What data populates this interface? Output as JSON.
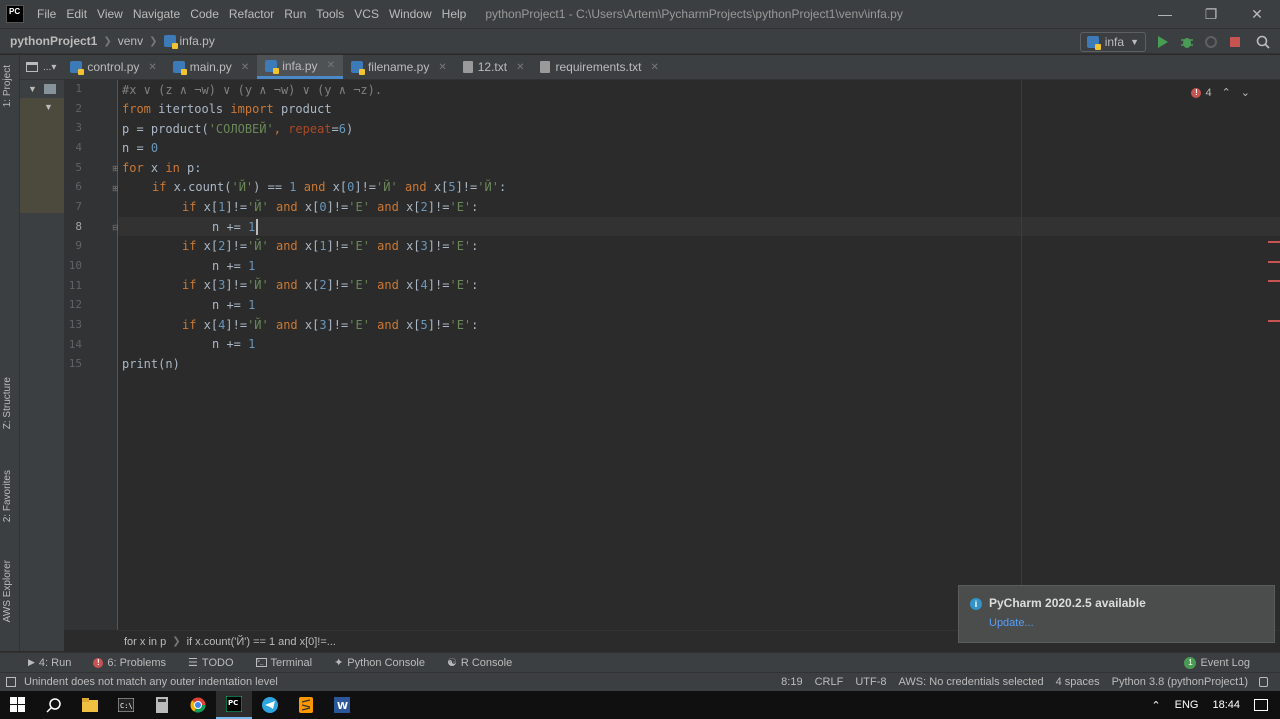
{
  "titlebar": {
    "logo": "PC",
    "menus": [
      "File",
      "Edit",
      "View",
      "Navigate",
      "Code",
      "Refactor",
      "Run",
      "Tools",
      "VCS",
      "Window",
      "Help"
    ],
    "window_title": "pythonProject1 - C:\\Users\\Artem\\PycharmProjects\\pythonProject1\\venv\\infa.py"
  },
  "navbar": {
    "project": "pythonProject1",
    "folder": "venv",
    "file": "infa.py",
    "run_config": "infa"
  },
  "tabs": [
    {
      "label": "control.py",
      "type": "py"
    },
    {
      "label": "main.py",
      "type": "py"
    },
    {
      "label": "infa.py",
      "type": "py",
      "active": true
    },
    {
      "label": "filename.py",
      "type": "py"
    },
    {
      "label": "12.txt",
      "type": "txt"
    },
    {
      "label": "requirements.txt",
      "type": "txt"
    }
  ],
  "left_strip": {
    "project": "1: Project",
    "structure": "Z: Structure",
    "favorites": "2: Favorites",
    "aws": "AWS Explorer"
  },
  "editor": {
    "line_numbers": [
      "1",
      "2",
      "3",
      "4",
      "5",
      "6",
      "7",
      "8",
      "9",
      "10",
      "11",
      "12",
      "13",
      "14",
      "15"
    ],
    "current_line": "8",
    "error_count": "4",
    "code": {
      "l1_comment": "#x ∨ (z ∧ ¬w) ∨ (y ∧ ¬w) ∨ (y ∧ ¬z).",
      "l2_from": "from",
      "l2_mod": " itertools ",
      "l2_import": "import",
      "l2_name": " product",
      "l3_a": "p = product(",
      "l3_str": "'СОЛОВЕЙ'",
      "l3_b": ", ",
      "l3_param": "repeat",
      "l3_c": "=",
      "l3_num": "6",
      "l3_d": ")",
      "l4_a": "n = ",
      "l4_num": "0",
      "l5_for": "for",
      "l5_a": " x ",
      "l5_in": "in",
      "l5_b": " p:",
      "l6_if": "if",
      "l6_a": " x.count(",
      "l6_s1": "'Й'",
      "l6_b": ") == ",
      "l6_n1": "1",
      "l6_and1": " and",
      "l6_c": " x[",
      "l6_n2": "0",
      "l6_d": "]!=",
      "l6_s2": "'Й'",
      "l6_and2": " and",
      "l6_e": " x[",
      "l6_n3": "5",
      "l6_f": "]!=",
      "l6_s3": "'Й'",
      "l6_g": ":",
      "l7_if": "if",
      "l7_a": " x[",
      "l7_n1": "1",
      "l7_b": "]!=",
      "l7_s1": "'Й'",
      "l7_and1": " and",
      "l7_c": " x[",
      "l7_n2": "0",
      "l7_d": "]!=",
      "l7_s2": "'Е'",
      "l7_and2": " and",
      "l7_e": " x[",
      "l7_n3": "2",
      "l7_f": "]!=",
      "l7_s3": "'Е'",
      "l7_g": ":",
      "l8_a": "n += ",
      "l8_num": "1",
      "l9_if": "if",
      "l9_a": " x[",
      "l9_n1": "2",
      "l9_b": "]!=",
      "l9_s1": "'Й'",
      "l9_and1": " and",
      "l9_c": " x[",
      "l9_n2": "1",
      "l9_d": "]!=",
      "l9_s2": "'Е'",
      "l9_and2": " and",
      "l9_e": " x[",
      "l9_n3": "3",
      "l9_f": "]!=",
      "l9_s3": "'Е'",
      "l9_g": ":",
      "l10_a": "n += ",
      "l10_num": "1",
      "l11_if": "if",
      "l11_a": " x[",
      "l11_n1": "3",
      "l11_b": "]!=",
      "l11_s1": "'Й'",
      "l11_and1": " and",
      "l11_c": " x[",
      "l11_n2": "2",
      "l11_d": "]!=",
      "l11_s2": "'Е'",
      "l11_and2": " and",
      "l11_e": " x[",
      "l11_n3": "4",
      "l11_f": "]!=",
      "l11_s3": "'Е'",
      "l11_g": ":",
      "l12_a": "n += ",
      "l12_num": "1",
      "l13_if": "if",
      "l13_a": " x[",
      "l13_n1": "4",
      "l13_b": "]!=",
      "l13_s1": "'Й'",
      "l13_and1": " and",
      "l13_c": " x[",
      "l13_n2": "3",
      "l13_d": "]!=",
      "l13_s2": "'Е'",
      "l13_and2": " and",
      "l13_e": " x[",
      "l13_n3": "5",
      "l13_f": "]!=",
      "l13_s3": "'Е'",
      "l13_g": ":",
      "l14_a": "n += ",
      "l14_num": "1",
      "l15_print": "print(n)"
    }
  },
  "editor_breadcrumbs": {
    "first": "for x in p",
    "second": "if x.count('Й') == 1 and x[0]!=..."
  },
  "notification": {
    "title": "PyCharm 2020.2.5 available",
    "link": "Update..."
  },
  "tool_windows": [
    "4: Run",
    "6: Problems",
    "TODO",
    "Terminal",
    "Python Console",
    "R Console"
  ],
  "event_log": "Event Log",
  "event_log_count": "1",
  "status": {
    "message": "Unindent does not match any outer indentation level",
    "position": "8:19",
    "line_sep": "CRLF",
    "encoding": "UTF-8",
    "aws": "AWS: No credentials selected",
    "indent": "4 spaces",
    "interpreter": "Python 3.8 (pythonProject1)"
  },
  "taskbar": {
    "lang": "ENG",
    "time": "18:44"
  },
  "colors": {
    "accent": "#4a88c7",
    "keyword": "#cc7832",
    "number": "#6897bb",
    "string": "#6a8759",
    "error": "#c75450"
  }
}
